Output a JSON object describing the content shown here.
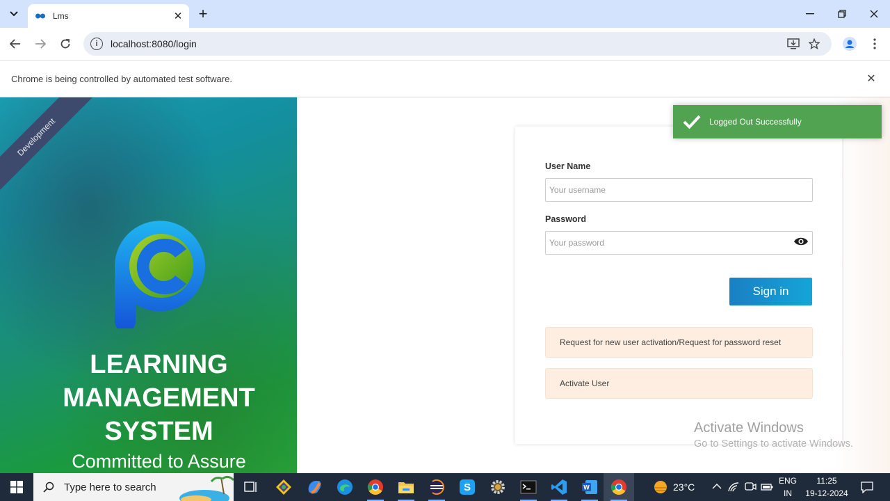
{
  "browser": {
    "tab_title": "Lms",
    "url": "localhost:8080/login",
    "infobar_text": "Chrome is being controlled by automated test software."
  },
  "left_panel": {
    "ribbon": "Development",
    "title_line1": "LEARNING",
    "title_line2": "MANAGEMENT",
    "title_line3": "SYSTEM",
    "tagline": "Committed to Assure"
  },
  "login": {
    "username_label": "User Name",
    "username_placeholder": "Your username",
    "password_label": "Password",
    "password_placeholder": "Your password",
    "signin_label": "Sign in",
    "request_notice": "Request for new user activation/Request for password reset",
    "activate_notice": "Activate User"
  },
  "toast": {
    "message": "Logged Out Successfully"
  },
  "watermark": {
    "title": "Activate Windows",
    "subtitle": "Go to Settings to activate Windows."
  },
  "taskbar": {
    "search_placeholder": "Type here to search",
    "weather": "23°C",
    "lang1": "ENG",
    "lang2": "IN",
    "time": "11:25",
    "date": "19-12-2024"
  },
  "colors": {
    "tabstrip": "#d3e3fd",
    "toast": "#51a351",
    "signin": "#1a7fc4",
    "notice": "#fdeee1",
    "taskbar": "#1f2a3a"
  }
}
